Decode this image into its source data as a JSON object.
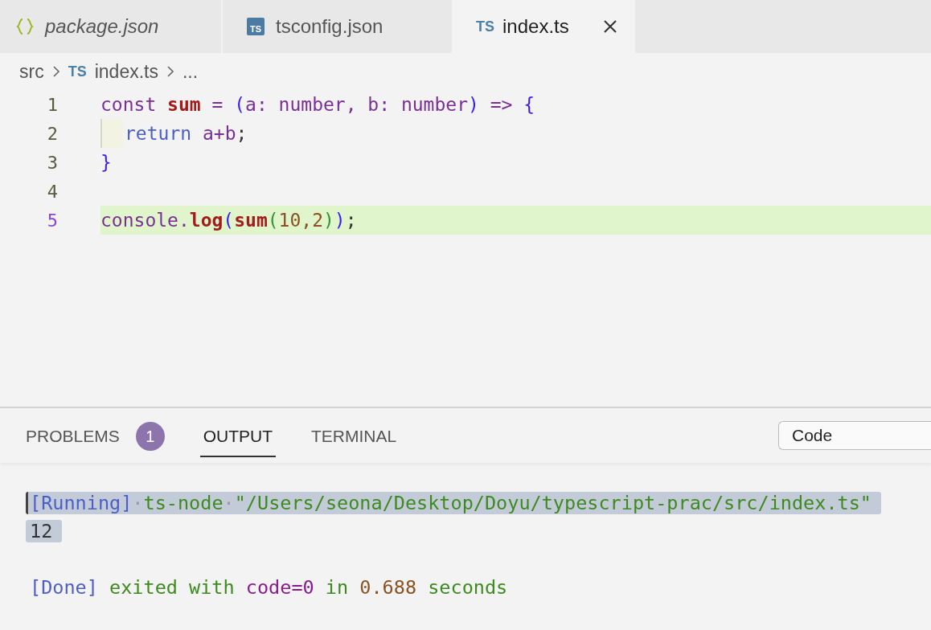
{
  "tabs": [
    {
      "label": "package.json",
      "kind": "json",
      "italic": true,
      "selected": false
    },
    {
      "label": "tsconfig.json",
      "kind": "tsconfig",
      "icon_text": "TS",
      "italic": false,
      "selected": false
    },
    {
      "label": "index.ts",
      "kind": "ts",
      "icon_text": "TS",
      "italic": false,
      "selected": true
    }
  ],
  "breadcrumb": {
    "folder": "src",
    "file_icon_text": "TS",
    "file": "index.ts",
    "more": "..."
  },
  "editor": {
    "lines": [
      {
        "number": "1",
        "current": false,
        "indent": false,
        "tokens": [
          {
            "text": "const ",
            "kind": "keyword"
          },
          {
            "text": "sum",
            "kind": "function"
          },
          {
            "text": " = ",
            "kind": "keyword"
          },
          {
            "text": "(",
            "kind": "bracket"
          },
          {
            "text": "a: number, b: number",
            "kind": "keyword"
          },
          {
            "text": ")",
            "kind": "bracket"
          },
          {
            "text": " => ",
            "kind": "keyword"
          },
          {
            "text": "{",
            "kind": "bracket"
          }
        ]
      },
      {
        "number": "2",
        "current": false,
        "indent": true,
        "tokens": [
          {
            "text": "return",
            "kind": "control"
          },
          {
            "text": " a+b",
            "kind": "keyword"
          },
          {
            "text": ";",
            "kind": "plain"
          }
        ]
      },
      {
        "number": "3",
        "current": false,
        "indent": false,
        "tokens": [
          {
            "text": "}",
            "kind": "bracket"
          }
        ]
      },
      {
        "number": "4",
        "current": false,
        "indent": false
      },
      {
        "number": "5",
        "current": true,
        "indent": false,
        "tokens": [
          {
            "text": "console.",
            "kind": "keyword"
          },
          {
            "text": "log",
            "kind": "function"
          },
          {
            "text": "(",
            "kind": "bracket"
          },
          {
            "text": "sum",
            "kind": "function"
          },
          {
            "text": "(",
            "kind": "bracket2"
          },
          {
            "text": "10,2",
            "kind": "number"
          },
          {
            "text": ")",
            "kind": "bracket2"
          },
          {
            "text": ")",
            "kind": "bracket"
          },
          {
            "text": ";",
            "kind": "plain"
          }
        ]
      }
    ]
  },
  "panel": {
    "tabs": [
      {
        "label": "PROBLEMS",
        "badge": "1",
        "selected": false
      },
      {
        "label": "OUTPUT",
        "selected": true
      },
      {
        "label": "TERMINAL",
        "selected": false
      }
    ],
    "dropdown": {
      "value": "Code"
    },
    "output": [
      {
        "selected": true,
        "tokens": [
          {
            "text": "[Running]",
            "kind": "tag"
          },
          {
            "text": "·",
            "kind": "space"
          },
          {
            "text": "ts-node",
            "kind": "green"
          },
          {
            "text": "·",
            "kind": "space"
          },
          {
            "text": "\"/Users/seona/Desktop/Doyu/typescript-prac/src/index.ts\"",
            "kind": "green"
          }
        ]
      },
      {
        "selected": true,
        "tokens": [
          {
            "text": "12",
            "kind": "plain"
          }
        ]
      },
      {
        "selected": false
      },
      {
        "selected": false,
        "tokens": [
          {
            "text": "[Done]",
            "kind": "tag"
          },
          {
            "text": " exited with ",
            "kind": "green"
          },
          {
            "text": "code=0",
            "kind": "purple"
          },
          {
            "text": " in ",
            "kind": "green"
          },
          {
            "text": "0.688",
            "kind": "number"
          },
          {
            "text": " seconds",
            "kind": "green"
          }
        ]
      }
    ]
  }
}
